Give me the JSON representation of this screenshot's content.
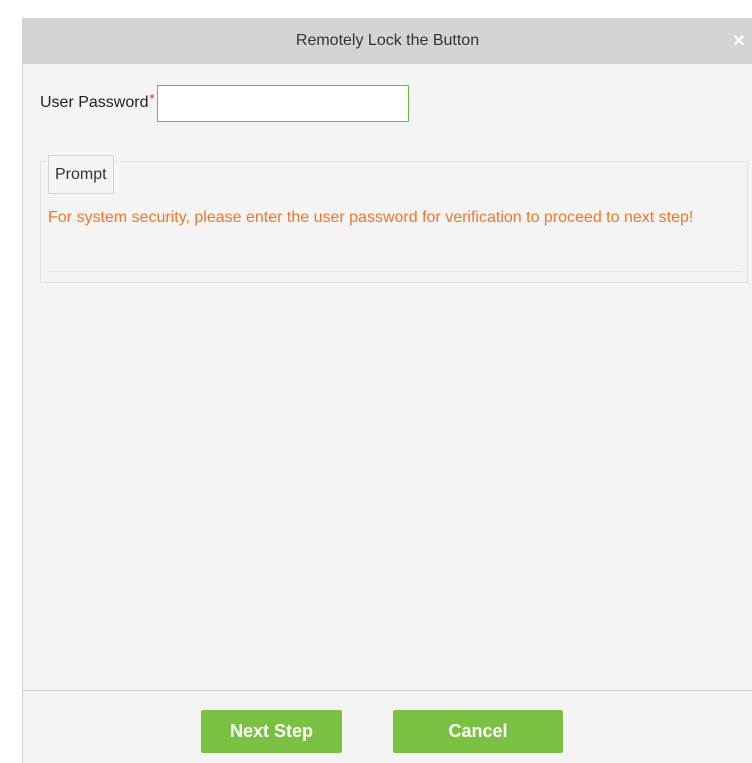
{
  "dialog": {
    "title": "Remotely Lock the Button",
    "close_glyph": "×"
  },
  "form": {
    "password_label": "User Password",
    "required_marker": "*",
    "password_value": "",
    "password_placeholder": ""
  },
  "prompt": {
    "legend": "Prompt",
    "message": "For system security, please enter the user password for verification to proceed to next step!"
  },
  "footer": {
    "next_label": "Next Step",
    "cancel_label": "Cancel"
  },
  "colors": {
    "accent_green": "#7ac143",
    "input_border": "#6cba3c",
    "prompt_text": "#ee7628",
    "required": "#e02020"
  },
  "icons": {
    "close": "close-icon"
  }
}
